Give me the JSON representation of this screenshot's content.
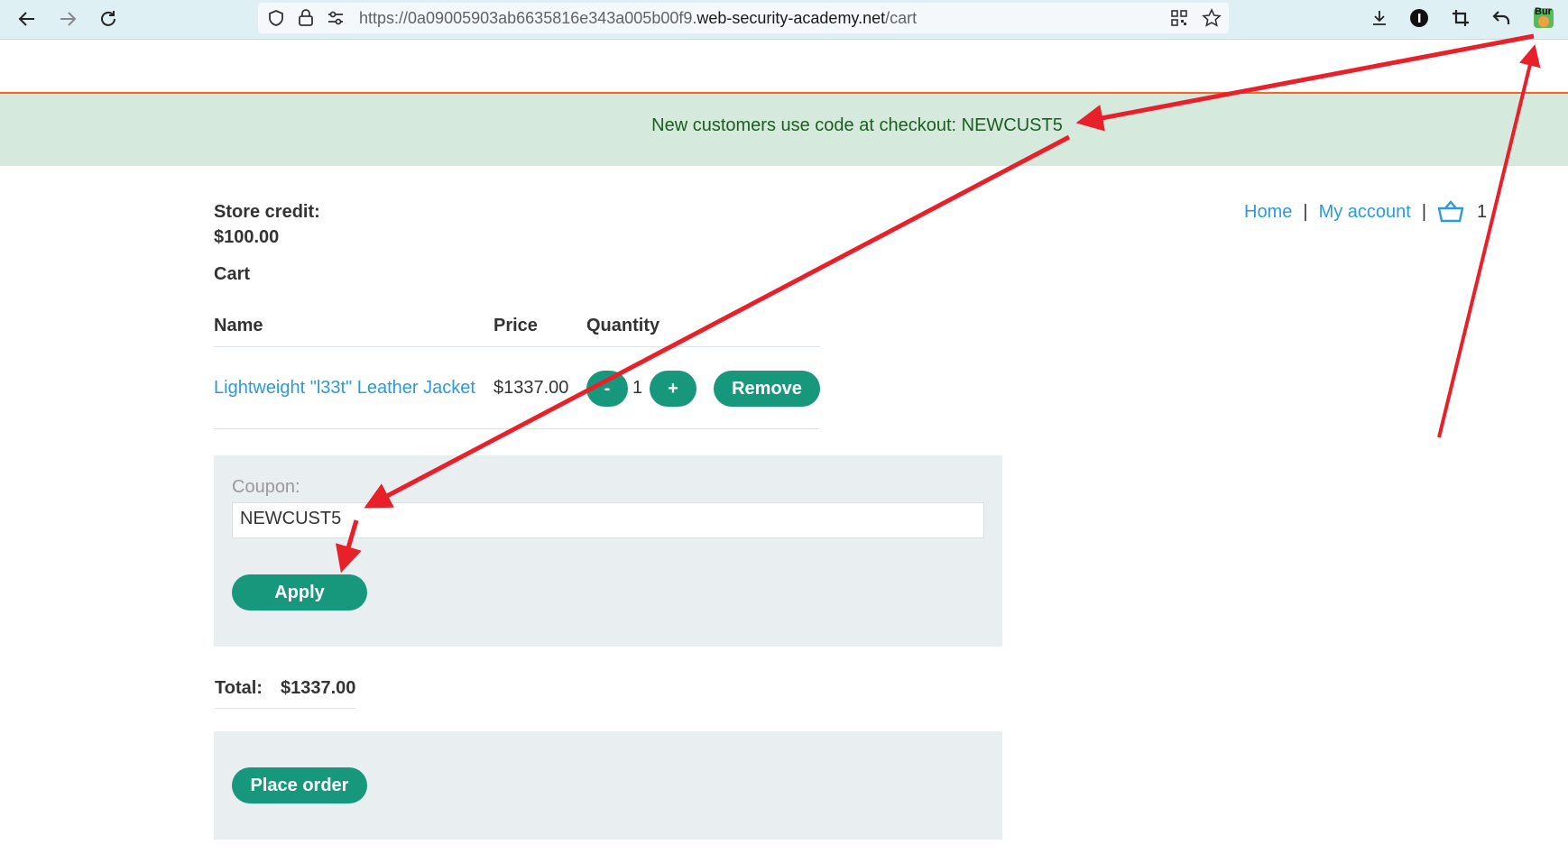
{
  "browser": {
    "url_prefix": "https://0a09005903ab6635816e343a005b00f9.",
    "url_host": "web-security-academy.net",
    "url_path": "/cart",
    "extension_badge": "Bur"
  },
  "banner": {
    "text": "New customers use code at checkout: NEWCUST5"
  },
  "account": {
    "store_credit_label": "Store credit:",
    "store_credit_value": "$100.00"
  },
  "nav": {
    "home": "Home",
    "separator": "|",
    "my_account": "My account",
    "cart_count": "1"
  },
  "cart": {
    "heading": "Cart",
    "columns": [
      "Name",
      "Price",
      "Quantity"
    ],
    "items": [
      {
        "name": "Lightweight \"l33t\" Leather Jacket",
        "price": "$1337.00",
        "quantity": "1",
        "decrement_label": "-",
        "increment_label": "+",
        "remove_label": "Remove"
      }
    ]
  },
  "coupon": {
    "label": "Coupon:",
    "value": "NEWCUST5",
    "apply_label": "Apply"
  },
  "total": {
    "label": "Total:",
    "value": "$1337.00"
  },
  "order": {
    "place_label": "Place order"
  },
  "colors": {
    "accent": "#17987c",
    "link": "#2c9ad9",
    "banner_bg": "#d5eadc",
    "annotation": "#e8202a"
  }
}
